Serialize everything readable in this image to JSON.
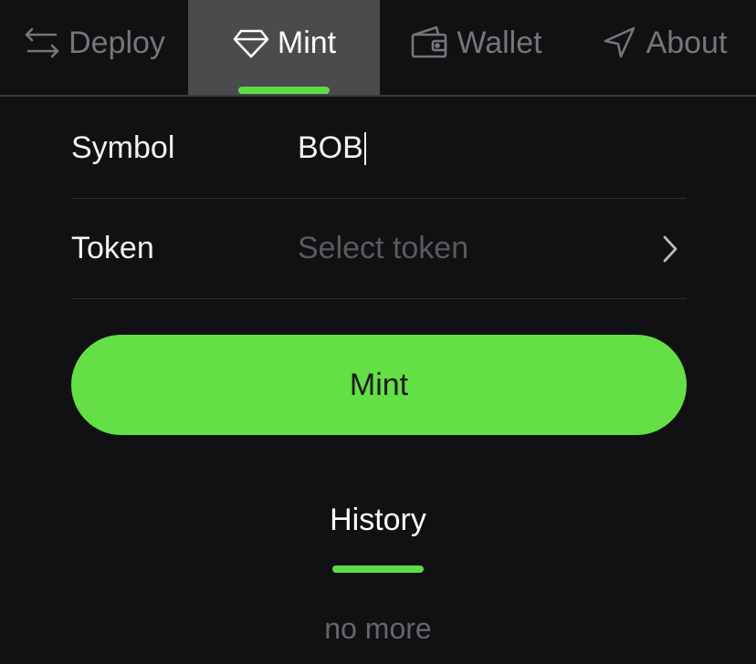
{
  "tabs": [
    {
      "label": "Deploy",
      "icon": "swap-arrows-icon",
      "active": false
    },
    {
      "label": "Mint",
      "icon": "diamond-icon",
      "active": true
    },
    {
      "label": "Wallet",
      "icon": "wallet-icon",
      "active": false
    },
    {
      "label": "About",
      "icon": "paper-plane-icon",
      "active": false
    }
  ],
  "form": {
    "symbol_label": "Symbol",
    "symbol_value": "BOB",
    "token_label": "Token",
    "token_placeholder": "Select token"
  },
  "mint_button_label": "Mint",
  "history": {
    "title": "History",
    "empty_text": "no more"
  },
  "colors": {
    "accent": "#64df45",
    "background": "#111113",
    "active_tab_bg": "#4b4b4d"
  }
}
